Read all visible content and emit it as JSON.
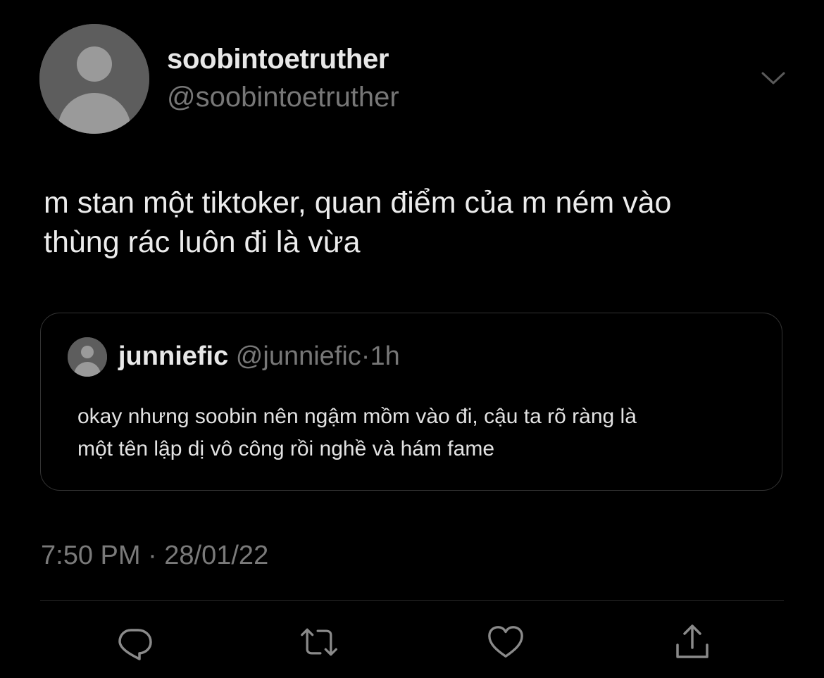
{
  "author": {
    "display_name": "soobintoetruther",
    "handle": "@soobintoetruther"
  },
  "tweet": {
    "text_line1": "m stan một tiktoker, quan điểm của m ném vào",
    "text_line2": "thùng rác luôn đi là vừa",
    "timestamp": "7:50 PM · 28/01/22"
  },
  "quoted_tweet": {
    "display_name": "junniefic",
    "handle": "@junniefic",
    "separator": "·",
    "time": "1h",
    "text_line1": "okay nhưng soobin nên ngậm mồm vào đi, cậu ta rõ ràng là",
    "text_line2": "một tên lập dị vô công rồi nghề và hám fame"
  },
  "icons": {
    "more": "chevron-down-icon",
    "reply": "reply-icon",
    "retweet": "retweet-icon",
    "like": "heart-icon",
    "share": "share-icon"
  },
  "colors": {
    "background": "#000000",
    "primary_text": "#e8e8e8",
    "secondary_text": "#777777",
    "avatar_placeholder": "#5d5d5d",
    "border": "#333333"
  }
}
